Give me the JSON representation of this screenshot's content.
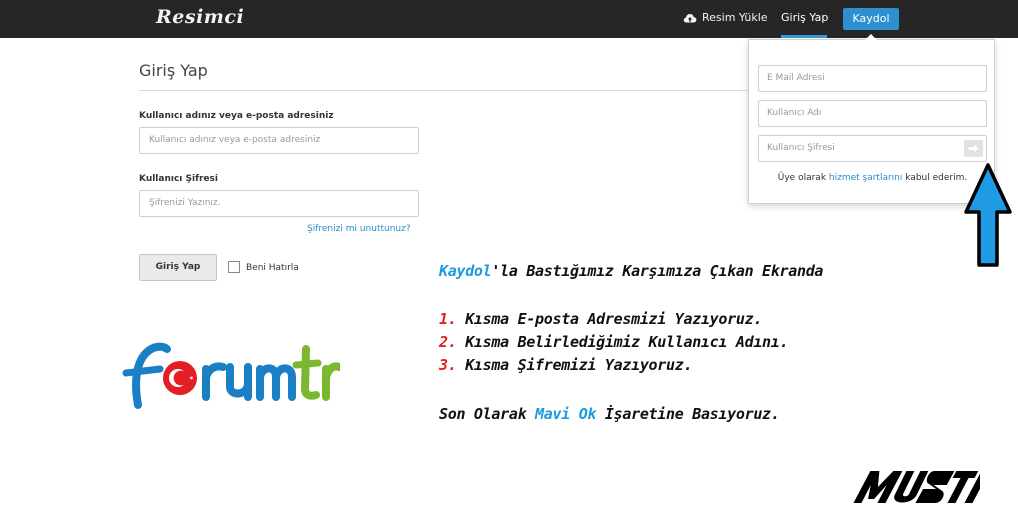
{
  "topbar": {
    "logo": "Resimci",
    "upload_label": "Resim Yükle",
    "login_label": "Giriş Yap",
    "register_label": "Kaydol"
  },
  "login_form": {
    "title": "Giriş Yap",
    "username_label": "Kullanıcı adınız veya e-posta adresiniz",
    "username_placeholder": "Kullanıcı adınız veya e-posta adresiniz",
    "password_label": "Kullanıcı Şifresi",
    "password_placeholder": "Şifrenizi Yazınız.",
    "forgot_link": "Şifrenizi mi unuttunuz?",
    "submit_label": "Giriş Yap",
    "remember_label": "Beni Hatırla",
    "remember_checked": false
  },
  "register_panel": {
    "email_placeholder": "E Mail Adresi",
    "username_placeholder": "Kullanıcı Adı",
    "password_placeholder": "Kullanıcı Şifresi",
    "terms_prefix": "Üye olarak",
    "terms_link": "hizmet şartlarını",
    "terms_suffix": "kabul ederim."
  },
  "annotation": {
    "line1_highlight": "Kaydol",
    "line1_rest": "'la Bastığımız Karşımıza Çıkan Ekranda",
    "step1_num": "1.",
    "step1_text": "Kısma E-posta Adresmizi Yazıyoruz.",
    "step2_num": "2.",
    "step2_text": "Kısma Belirlediğimiz Kullanıcı Adını.",
    "step3_num": "3.",
    "step3_text": "Kısma Şifremizi Yazıyoruz.",
    "final_prefix": "Son Olarak",
    "final_highlight": "Mavi Ok",
    "final_suffix": "İşaretine Basıyoruz."
  },
  "logos": {
    "forumtr": "forumtr",
    "signature": "MUSTI"
  },
  "colors": {
    "accent_blue": "#2d8ed0",
    "highlight_blue": "#1a9be0",
    "step_red": "#e02020",
    "topbar_bg": "#262626"
  }
}
